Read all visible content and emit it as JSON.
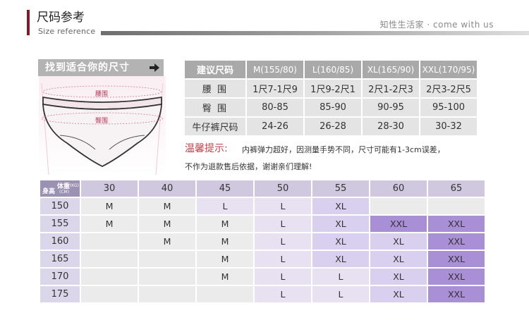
{
  "header": {
    "title": "尺码参考",
    "subtitle": "Size reference",
    "brand": "知性生活家 · come with us"
  },
  "finder": {
    "banner": "找到适合你的尺寸",
    "waist_label": "腰围",
    "hip_label": "臀围"
  },
  "size_table": {
    "corner": "建议尺码",
    "sizes": [
      "M(155/80)",
      "L(160/85)",
      "XL(165/90)",
      "XXL(170/95)"
    ],
    "rows": [
      {
        "label": "腰 围",
        "values": [
          "1尺7-1尺9",
          "1尺9-2尺1",
          "2尺1-2尺3",
          "2尺3-2尺5"
        ]
      },
      {
        "label": "臀 围",
        "values": [
          "80-85",
          "85-90",
          "90-95",
          "95-100"
        ]
      },
      {
        "label": "牛仔裤尺码",
        "values": [
          "24-26",
          "26-28",
          "28-30",
          "30-32"
        ]
      }
    ]
  },
  "tip": {
    "title": "温馨提示:",
    "line1": "内裤弹力超好，因测量手势不同，尺寸可能有1-3cm误差，",
    "line2": "不作为退款售后依据，谢谢亲们理解!"
  },
  "grid": {
    "corner_weight": "体重",
    "corner_weight_unit": "(KG)",
    "corner_height": "身高",
    "corner_height_unit": "(CM)",
    "weights": [
      "30",
      "40",
      "45",
      "50",
      "55",
      "60",
      "65"
    ],
    "rows": [
      {
        "height": "150",
        "cells": [
          "M",
          "M",
          "L",
          "L",
          "XL",
          "",
          ""
        ]
      },
      {
        "height": "155",
        "cells": [
          "M",
          "M",
          "M",
          "L",
          "XL",
          "XXL",
          "XXL"
        ]
      },
      {
        "height": "160",
        "cells": [
          "",
          "M",
          "M",
          "L",
          "XL",
          "XL",
          "XXL"
        ]
      },
      {
        "height": "165",
        "cells": [
          "",
          "",
          "M",
          "L",
          "XL",
          "XL",
          "XXL"
        ]
      },
      {
        "height": "170",
        "cells": [
          "",
          "",
          "M",
          "L",
          "L",
          "XL",
          "XXL"
        ]
      },
      {
        "height": "175",
        "cells": [
          "",
          "",
          "",
          "L",
          "L",
          "XL",
          "XXL"
        ]
      }
    ]
  }
}
